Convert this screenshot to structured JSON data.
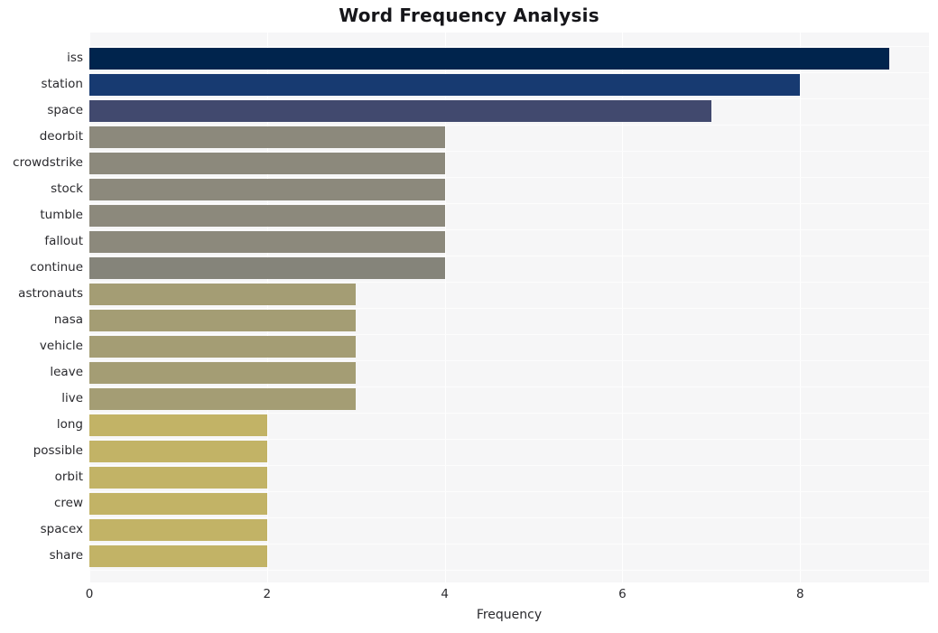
{
  "chart_data": {
    "type": "bar",
    "orientation": "horizontal",
    "title": "Word Frequency Analysis",
    "xlabel": "Frequency",
    "ylabel": "",
    "categories": [
      "iss",
      "station",
      "space",
      "deorbit",
      "crowdstrike",
      "stock",
      "tumble",
      "fallout",
      "continue",
      "astronauts",
      "nasa",
      "vehicle",
      "leave",
      "live",
      "long",
      "possible",
      "orbit",
      "crew",
      "spacex",
      "share"
    ],
    "values": [
      9,
      8,
      7,
      4,
      4,
      4,
      4,
      4,
      4,
      3,
      3,
      3,
      3,
      3,
      2,
      2,
      2,
      2,
      2,
      2
    ],
    "bar_colors": [
      "#00244d",
      "#173a71",
      "#41496e",
      "#8c897c",
      "#8c897c",
      "#8c897c",
      "#8c897c",
      "#8c897c",
      "#85847a",
      "#a49d74",
      "#a49d74",
      "#a49d74",
      "#a49d74",
      "#a49d74",
      "#c2b366",
      "#c2b366",
      "#c2b366",
      "#c2b366",
      "#c2b366",
      "#c2b366"
    ],
    "xlim": [
      0,
      9.45
    ],
    "x_ticks": [
      0,
      2,
      4,
      6,
      8
    ],
    "x_tick_labels": [
      "0",
      "2",
      "4",
      "6",
      "8"
    ],
    "grid": true,
    "grid_color": "#ffffff",
    "plot_background": "#f6f6f7",
    "figure_background": "#ffffff",
    "legend": null,
    "legend_position": "none"
  },
  "style": {
    "title_color": "#16161a",
    "tick_color": "#2a2a2e",
    "axis_label_color": "#2a2a2e"
  }
}
